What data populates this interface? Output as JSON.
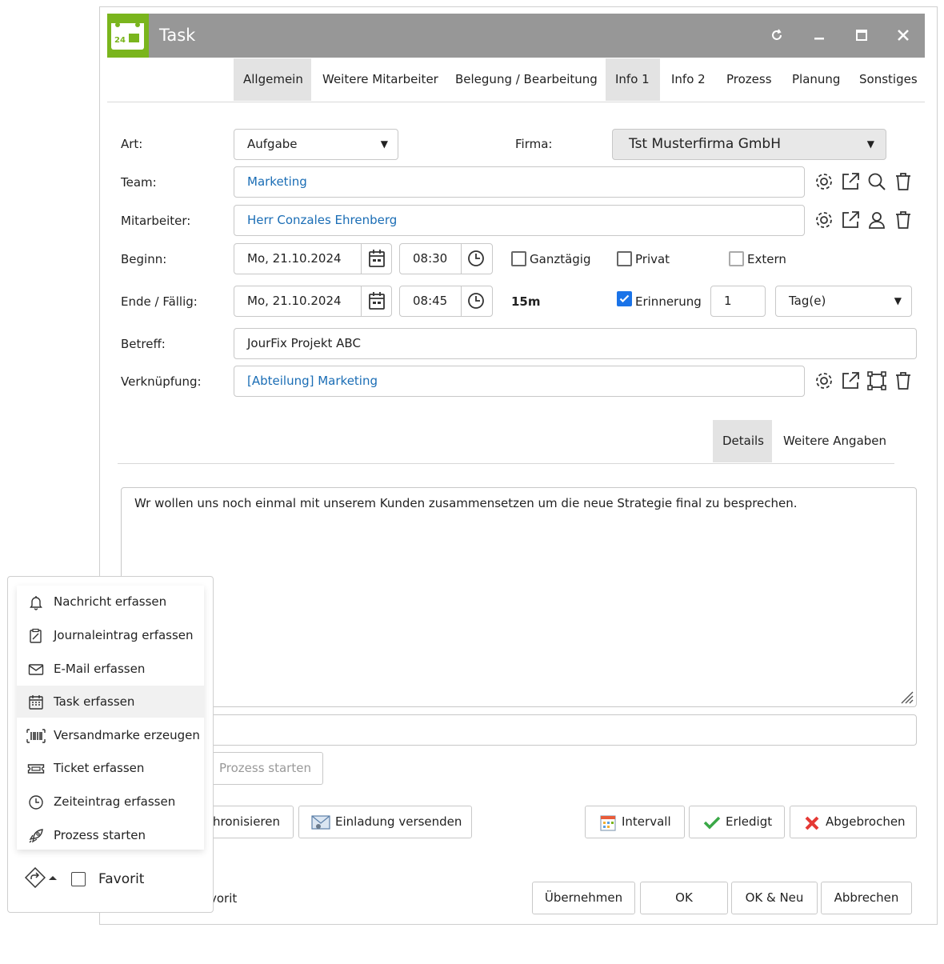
{
  "window": {
    "title": "Task",
    "app_icon_text": "24"
  },
  "tabs": [
    {
      "label": "Allgemein",
      "active": true
    },
    {
      "label": "Weitere Mitarbeiter"
    },
    {
      "label": "Belegung / Bearbeitung"
    },
    {
      "label": "Info 1",
      "active": true
    },
    {
      "label": "Info 2"
    },
    {
      "label": "Prozess"
    },
    {
      "label": "Planung"
    },
    {
      "label": "Sonstiges"
    }
  ],
  "form": {
    "art": {
      "label": "Art:",
      "value": "Aufgabe"
    },
    "firma": {
      "label": "Firma:",
      "value": "Tst Musterfirma GmbH"
    },
    "team": {
      "label": "Team:",
      "value": "Marketing"
    },
    "mitarbeiter": {
      "label": "Mitarbeiter:",
      "value": "Herr Conzales Ehrenberg"
    },
    "beginn": {
      "label": "Beginn:",
      "date": "Mo, 21.10.2024",
      "time": "08:30"
    },
    "ende": {
      "label": "Ende / Fällig:",
      "date": "Mo, 21.10.2024",
      "time": "08:45",
      "duration": "15m"
    },
    "ganztaegig": {
      "label": "Ganztägig",
      "checked": false
    },
    "privat": {
      "label": "Privat",
      "checked": false
    },
    "extern": {
      "label": "Extern",
      "checked": false
    },
    "erinnerung": {
      "label": "Erinnerung",
      "checked": true,
      "value": "1",
      "unit": "Tag(e)"
    },
    "betreff": {
      "label": "Betreff:",
      "value": "JourFix Projekt ABC"
    },
    "verknuepfung": {
      "label": "Verknüpfung:",
      "value": "[Abteilung] Marketing"
    }
  },
  "subtabs": [
    {
      "label": "Details",
      "active": true
    },
    {
      "label": "Weitere Angaben"
    }
  ],
  "details_text": "Wr wollen uns noch einmal mit unserem Kunden zusammensetzen um die neue Strategie final zu besprechen.",
  "actions": {
    "prozess_starten": "Prozess starten",
    "synchronisieren_partial": "hronisieren",
    "einladung": "Einladung versenden",
    "intervall": "Intervall",
    "erledigt": "Erledigt",
    "abgebrochen": "Abgebrochen",
    "favorit_partial": "vorit",
    "uebernehmen": "Übernehmen",
    "ok": "OK",
    "ok_neu": "OK & Neu",
    "abbrechen": "Abbrechen"
  },
  "menu": {
    "items": [
      {
        "label": "Nachricht erfassen",
        "icon": "bell-icon"
      },
      {
        "label": "Journaleintrag erfassen",
        "icon": "journal-icon"
      },
      {
        "label": "E-Mail erfassen",
        "icon": "mail-icon"
      },
      {
        "label": "Task erfassen",
        "icon": "calendar-icon",
        "highlighted": true
      },
      {
        "label": "Versandmarke erzeugen",
        "icon": "barcode-icon"
      },
      {
        "label": "Ticket erfassen",
        "icon": "ticket-icon"
      },
      {
        "label": "Zeiteintrag erfassen",
        "icon": "clock-icon"
      },
      {
        "label": "Prozess starten",
        "icon": "rocket-icon"
      }
    ],
    "favorit": {
      "label": "Favorit",
      "checked": false
    }
  },
  "colors": {
    "titlebar": "#979797",
    "accent_green": "#7ab51d",
    "link": "#1a6db5",
    "checkbox": "#1a73e8"
  }
}
